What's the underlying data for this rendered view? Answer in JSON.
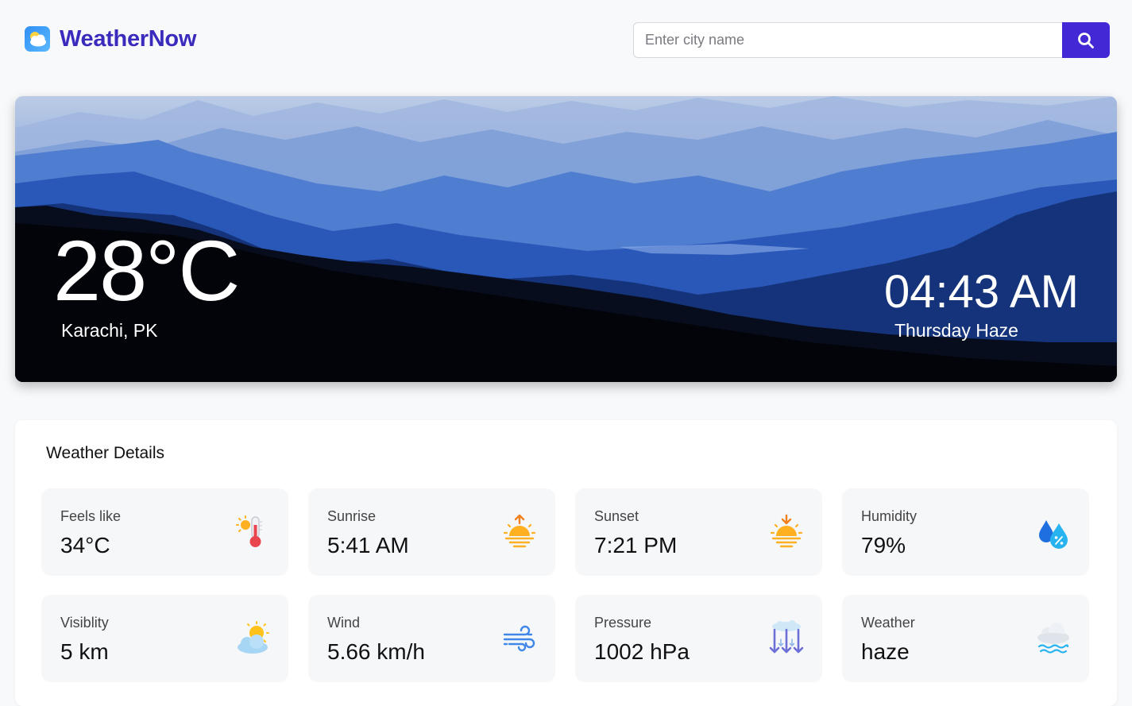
{
  "header": {
    "brand_name": "WeatherNow",
    "search_placeholder": "Enter city name"
  },
  "hero": {
    "temperature": "28°C",
    "location": "Karachi, PK",
    "time": "04:43 AM",
    "day_description": "Thursday Haze"
  },
  "details": {
    "title": "Weather Details",
    "cards": [
      {
        "label": "Feels like",
        "value": "34°C",
        "icon": "thermometer-sun-icon"
      },
      {
        "label": "Sunrise",
        "value": "5:41 AM",
        "icon": "sunrise-icon"
      },
      {
        "label": "Sunset",
        "value": "7:21 PM",
        "icon": "sunset-icon"
      },
      {
        "label": "Humidity",
        "value": "79%",
        "icon": "humidity-drops-icon"
      },
      {
        "label": "Visiblity",
        "value": "5 km",
        "icon": "sun-behind-cloud-icon"
      },
      {
        "label": "Wind",
        "value": "5.66 km/h",
        "icon": "wind-icon"
      },
      {
        "label": "Pressure",
        "value": "1002 hPa",
        "icon": "pressure-arrows-icon"
      },
      {
        "label": "Weather",
        "value": "haze",
        "icon": "haze-cloud-icon"
      }
    ]
  },
  "colors": {
    "brand": "#3a2bbd",
    "search_button": "#4328d6",
    "page_bg": "#f8f9fb"
  }
}
